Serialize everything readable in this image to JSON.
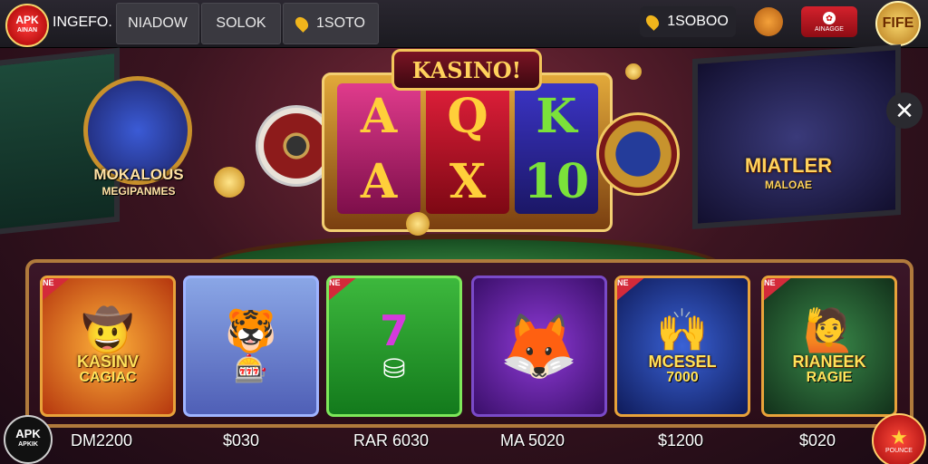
{
  "topbar": {
    "logo_main": "APK",
    "logo_sub": "AINAN",
    "brand": "INGEFO.",
    "nav": [
      "NIADOW",
      "SOLOK"
    ],
    "location_value": "1SOTO",
    "balance": "1SOBOO",
    "badge_label": "AINAGGE",
    "coin_label": "FIFE"
  },
  "hero": {
    "slot_title": "KASINO!",
    "reels": [
      [
        "A",
        "A"
      ],
      [
        "Q",
        "X"
      ],
      [
        "K",
        "10"
      ]
    ],
    "left_title": "MOKALOUS",
    "left_sub": "MEGIPANMES",
    "right_title": "MIATLER",
    "right_sub": "MALOAE"
  },
  "games": [
    {
      "tag": "NE",
      "title": "KASINV",
      "sub": "CAGIAC",
      "icon": "cowboy-icon",
      "price": "DM2200"
    },
    {
      "tag": "",
      "title": "",
      "sub": "",
      "icon": "tiger-icon",
      "price": "$030"
    },
    {
      "tag": "NE",
      "title": "",
      "sub": "",
      "icon": "seven-chip-icon",
      "price": "RAR 6030"
    },
    {
      "tag": "",
      "title": "",
      "sub": "",
      "icon": "roulette-tiger-icon",
      "price": "MA 5020"
    },
    {
      "tag": "NE",
      "title": "MCESEL",
      "sub": "7000",
      "icon": "people-icon",
      "price": "$1200"
    },
    {
      "tag": "NE",
      "title": "RIANEEK",
      "sub": "RAGIE",
      "icon": "people-icon",
      "price": "$020"
    }
  ],
  "bottom": {
    "apk_main": "APK",
    "apk_sub": "APKIK",
    "star_label": "POUNCE"
  },
  "colors": {
    "accent_gold": "#f0b51c",
    "brand_red": "#d4212c"
  }
}
